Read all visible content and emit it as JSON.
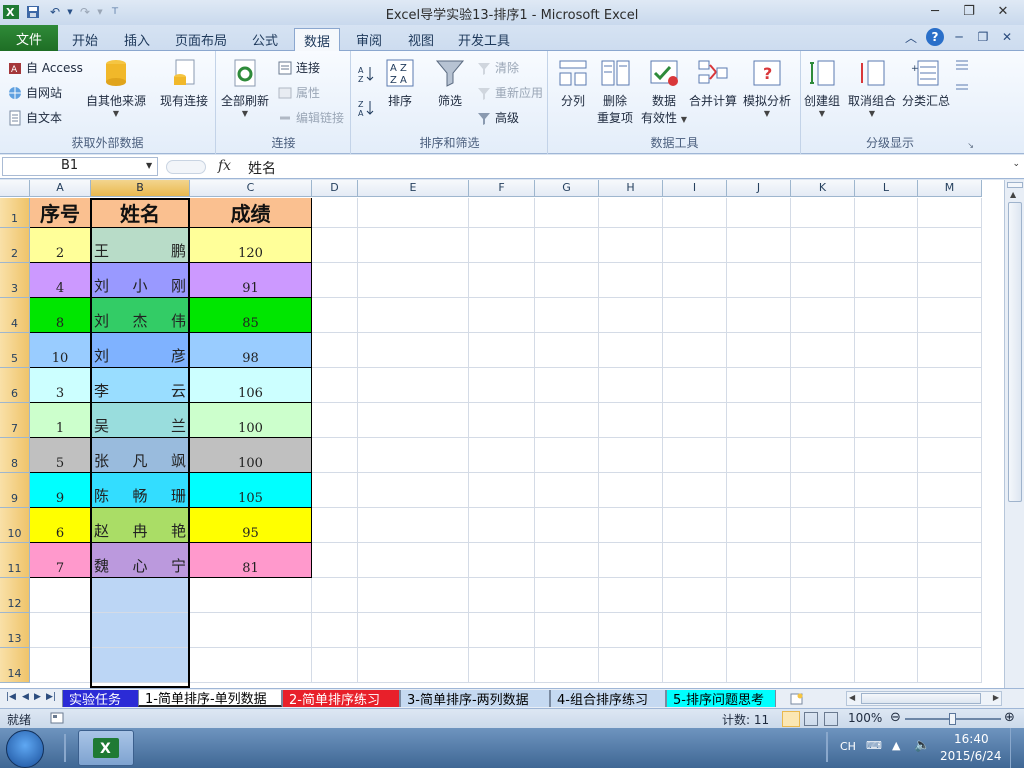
{
  "app": {
    "title": "Excel导学实验13-排序1  -  Microsoft Excel"
  },
  "tabs": [
    {
      "label": "文件"
    },
    {
      "label": "开始"
    },
    {
      "label": "插入"
    },
    {
      "label": "页面布局"
    },
    {
      "label": "公式"
    },
    {
      "label": "数据"
    },
    {
      "label": "审阅"
    },
    {
      "label": "视图"
    },
    {
      "label": "开发工具"
    }
  ],
  "ribbon": {
    "get_external": {
      "label": "获取外部数据",
      "access": "自 Access",
      "web": "自网站",
      "text": "自文本",
      "other": "自其他来源",
      "existing": "现有连接"
    },
    "connections": {
      "label": "连接",
      "refresh_all": "全部刷新",
      "connections": "连接",
      "properties": "属性",
      "edit_links": "编辑链接"
    },
    "sort_filter": {
      "label": "排序和筛选",
      "sort": "排序",
      "filter": "筛选",
      "clear": "清除",
      "reapply": "重新应用",
      "advanced": "高级"
    },
    "data_tools": {
      "label": "数据工具",
      "text_to_columns": "分列",
      "remove_dup_1": "删除",
      "remove_dup_2": "重复项",
      "validation_1": "数据",
      "validation_2": "有效性",
      "consolidate": "合并计算",
      "what_if": "模拟分析"
    },
    "outline": {
      "label": "分级显示",
      "group": "创建组",
      "ungroup": "取消组合",
      "subtotal": "分类汇总"
    }
  },
  "formula_bar": {
    "name_box": "B1",
    "fx": "fx",
    "value": "姓名"
  },
  "columns": [
    "A",
    "B",
    "C",
    "D",
    "E",
    "F",
    "G",
    "H",
    "I",
    "J",
    "K",
    "L",
    "M"
  ],
  "rows": [
    "1",
    "2",
    "3",
    "4",
    "5",
    "6",
    "7",
    "8",
    "9",
    "10",
    "11",
    "12",
    "13",
    "14"
  ],
  "table": {
    "headers": [
      "序号",
      "姓名",
      "成绩"
    ],
    "header_color": "#fac090",
    "records": [
      {
        "num": "2",
        "name": [
          "王",
          "鹏"
        ],
        "score": "120",
        "color": "#ffff99",
        "name_color": "#b8dcc8"
      },
      {
        "num": "4",
        "name": [
          "刘",
          "小",
          "刚"
        ],
        "score": "91",
        "color": "#cc99ff",
        "name_color": "#9999ff"
      },
      {
        "num": "8",
        "name": [
          "刘",
          "杰",
          "伟"
        ],
        "score": "85",
        "color": "#00e600",
        "name_color": "#33cc66"
      },
      {
        "num": "10",
        "name": [
          "刘",
          "彦"
        ],
        "score": "98",
        "color": "#99ccff",
        "name_color": "#7fb2ff"
      },
      {
        "num": "3",
        "name": [
          "李",
          "云"
        ],
        "score": "106",
        "color": "#ccffff",
        "name_color": "#99ddff"
      },
      {
        "num": "1",
        "name": [
          "吴",
          "兰"
        ],
        "score": "100",
        "color": "#ccffcc",
        "name_color": "#99dddd"
      },
      {
        "num": "5",
        "name": [
          "张",
          "凡",
          "飒"
        ],
        "score": "100",
        "color": "#c0c0c0",
        "name_color": "#99bbdd"
      },
      {
        "num": "9",
        "name": [
          "陈",
          "畅",
          "珊"
        ],
        "score": "105",
        "color": "#00ffff",
        "name_color": "#33ddff"
      },
      {
        "num": "6",
        "name": [
          "赵",
          "冉",
          "艳"
        ],
        "score": "95",
        "color": "#ffff00",
        "name_color": "#aadd66"
      },
      {
        "num": "7",
        "name": [
          "魏",
          "心",
          "宁"
        ],
        "score": "81",
        "color": "#ff99cc",
        "name_color": "#bb99dd"
      }
    ]
  },
  "sheet_tabs": [
    {
      "label": "实验任务",
      "bg": "#2b2bd6",
      "fg": "#ffffff"
    },
    {
      "label": "1-简单排序-单列数据",
      "bg": "#ffffff",
      "fg": "#000000"
    },
    {
      "label": "2-简单排序练习",
      "bg": "#e8202a",
      "fg": "#ffffff"
    },
    {
      "label": "3-简单排序-两列数据",
      "bg": "#c5d9f1",
      "fg": "#000000"
    },
    {
      "label": "4-组合排序练习",
      "bg": "#c5d9f1",
      "fg": "#000000"
    },
    {
      "label": "5-排序问题思考",
      "bg": "#00ffff",
      "fg": "#000000"
    }
  ],
  "status": {
    "ready": "就绪",
    "count": "计数: 11",
    "zoom": "100%",
    "zoom_level": 100
  },
  "taskbar": {
    "lang": "CH",
    "time": "16:40",
    "date": "2015/6/24"
  }
}
